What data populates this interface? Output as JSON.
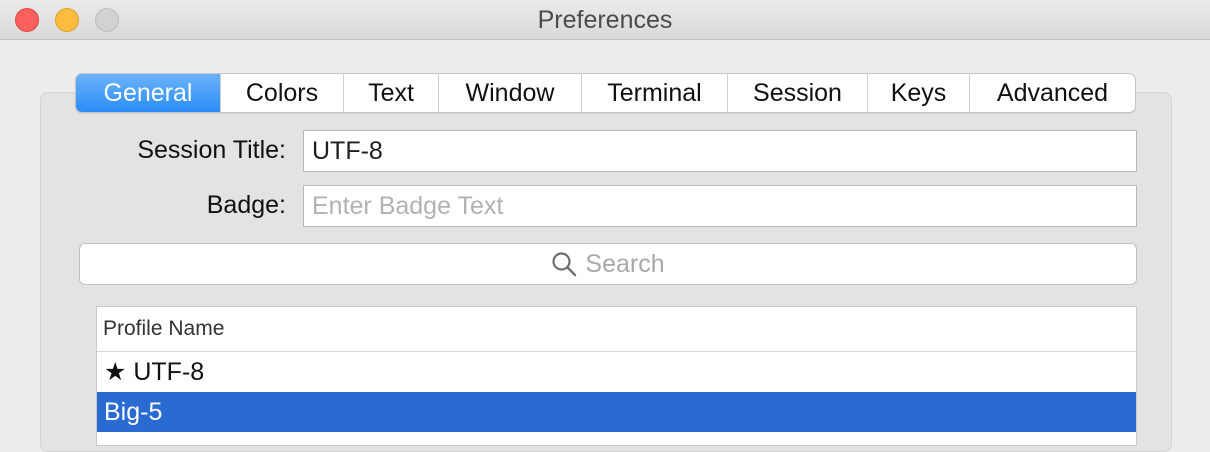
{
  "window": {
    "title": "Preferences"
  },
  "tabs": [
    {
      "label": "General",
      "active": true
    },
    {
      "label": "Colors",
      "active": false
    },
    {
      "label": "Text",
      "active": false
    },
    {
      "label": "Window",
      "active": false
    },
    {
      "label": "Terminal",
      "active": false
    },
    {
      "label": "Session",
      "active": false
    },
    {
      "label": "Keys",
      "active": false
    },
    {
      "label": "Advanced",
      "active": false
    }
  ],
  "form": {
    "session_title_label": "Session Title:",
    "session_title_value": "UTF-8",
    "badge_label": "Badge:",
    "badge_placeholder": "Enter Badge Text"
  },
  "search": {
    "placeholder": "Search",
    "icon": "search-icon"
  },
  "profiles": {
    "header": "Profile Name",
    "rows": [
      {
        "name": "★ UTF-8",
        "selected": false
      },
      {
        "name": "Big-5",
        "selected": true
      }
    ]
  },
  "colors": {
    "accent": "#2a8cf5",
    "selection": "#2a6bd2"
  }
}
